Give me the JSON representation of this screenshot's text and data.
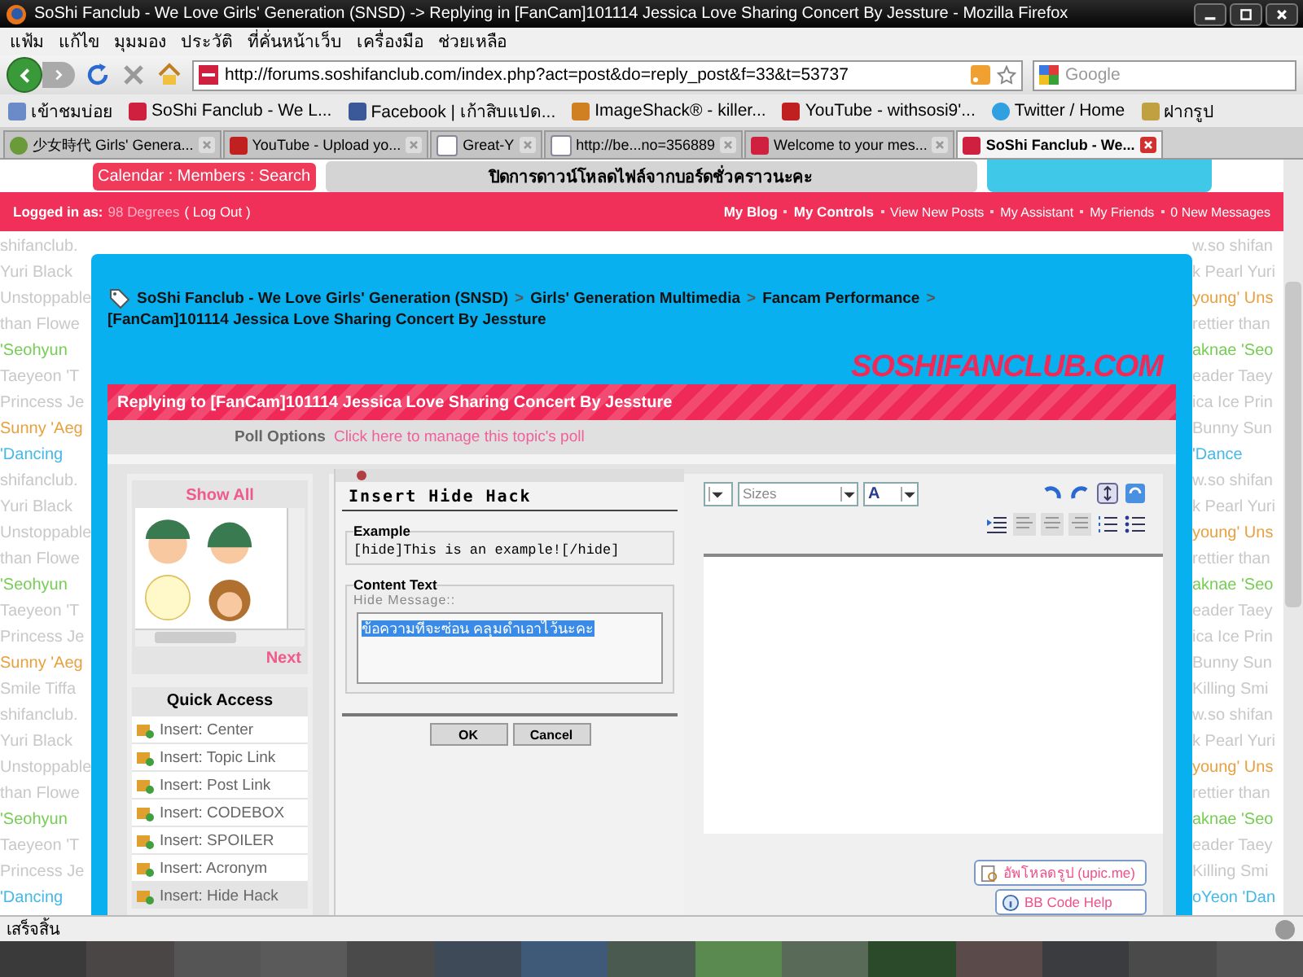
{
  "window": {
    "title": "SoShi Fanclub - We Love Girls' Generation (SNSD) -> Replying in [FanCam]101114 Jessica Love Sharing Concert By Jessture - Mozilla Firefox"
  },
  "menu": [
    "แฟ้ม",
    "แก้ไข",
    "มุมมอง",
    "ประวัติ",
    "ที่คั่นหน้าเว็บ",
    "เครื่องมือ",
    "ช่วยเหลือ"
  ],
  "nav": {
    "url": "http://forums.soshifanclub.com/index.php?act=post&do=reply_post&f=33&t=53737",
    "search_placeholder": "Google"
  },
  "bookmarks": [
    {
      "label": "เข้าชมบ่อย",
      "kind": "folder"
    },
    {
      "label": "SoShi Fanclub - We L...",
      "kind": "site"
    },
    {
      "label": "Facebook | เก้าสิบแปด...",
      "kind": "facebook"
    },
    {
      "label": "ImageShack® - killer...",
      "kind": "frog"
    },
    {
      "label": "YouTube - withsosi9'...",
      "kind": "youtube"
    },
    {
      "label": "Twitter / Home",
      "kind": "bird"
    },
    {
      "label": "ฝากรูป",
      "kind": "picture"
    }
  ],
  "tabs": [
    {
      "label": "少女時代 Girls' Genera...",
      "kind": "face",
      "selected": false
    },
    {
      "label": "YouTube - Upload yo...",
      "kind": "youtube",
      "selected": false
    },
    {
      "label": "Great-Y",
      "kind": "page",
      "selected": false
    },
    {
      "label": "http://be...no=356889",
      "kind": "page",
      "selected": false
    },
    {
      "label": "Welcome to your mes...",
      "kind": "site",
      "selected": false
    },
    {
      "label": "SoShi Fanclub - We...",
      "kind": "site",
      "selected": true
    }
  ],
  "page": {
    "top_links": "Calendar : Members : Search",
    "notice": "ปิดการดาวน์โหลดไฟล์จากบอร์ดชั่วคราวนะคะ",
    "user_bar": {
      "prefix": "Logged in as:",
      "user": "98 Degrees",
      "logout": "( Log Out )",
      "links": [
        {
          "label": "My Blog",
          "bold": true
        },
        {
          "label": "My Controls",
          "bold": true
        },
        {
          "label": "View New Posts",
          "bold": false
        },
        {
          "label": "My Assistant",
          "bold": false
        },
        {
          "label": "My Friends",
          "bold": false
        },
        {
          "label": "0 New Messages",
          "bold": false
        }
      ]
    }
  },
  "background_words": {
    "left": [
      {
        "text": "shifanclub.",
        "color": "#c8c8c8"
      },
      {
        "text": "Yuri Black",
        "color": "#c8c8c8"
      },
      {
        "text": "Unstoppable",
        "color": "#c8c8c8"
      },
      {
        "text": "than Flowe",
        "color": "#c8c8c8"
      },
      {
        "text": "'Seohyun",
        "color": "#77cc55"
      },
      {
        "text": "Taeyeon 'T",
        "color": "#c8c8c8"
      },
      {
        "text": "Princess Je",
        "color": "#c8c8c8"
      },
      {
        "text": "Sunny 'Aeg",
        "color": "#e8a040"
      },
      {
        "text": "'Dancing",
        "color": "#44b8e8"
      },
      {
        "text": "shifanclub.",
        "color": "#c8c8c8"
      },
      {
        "text": "Yuri Black",
        "color": "#c8c8c8"
      },
      {
        "text": "Unstoppable",
        "color": "#c8c8c8"
      },
      {
        "text": "than Flowe",
        "color": "#c8c8c8"
      },
      {
        "text": "'Seohyun",
        "color": "#77cc55"
      },
      {
        "text": "Taeyeon 'T",
        "color": "#c8c8c8"
      },
      {
        "text": "Princess Je",
        "color": "#c8c8c8"
      },
      {
        "text": "Sunny 'Aeg",
        "color": "#e8a040"
      },
      {
        "text": "Smile Tiffa",
        "color": "#c8c8c8"
      },
      {
        "text": "shifanclub.",
        "color": "#c8c8c8"
      },
      {
        "text": "Yuri Black",
        "color": "#c8c8c8"
      },
      {
        "text": "Unstoppable",
        "color": "#c8c8c8"
      },
      {
        "text": "than Flowe",
        "color": "#c8c8c8"
      },
      {
        "text": "'Seohyun",
        "color": "#77cc55"
      },
      {
        "text": "Taeyeon 'T",
        "color": "#c8c8c8"
      },
      {
        "text": "Princess Je",
        "color": "#c8c8c8"
      },
      {
        "text": "'Dancing",
        "color": "#44b8e8"
      }
    ],
    "right": [
      {
        "text": "w.so shifan",
        "color": "#c8c8c8"
      },
      {
        "text": "k Pearl Yuri",
        "color": "#c8c8c8"
      },
      {
        "text": "young' Uns",
        "color": "#e8a040"
      },
      {
        "text": "rettier than",
        "color": "#c8c8c8"
      },
      {
        "text": "aknae 'Seo",
        "color": "#77cc55"
      },
      {
        "text": "eader Taey",
        "color": "#c8c8c8"
      },
      {
        "text": "ica Ice Prin",
        "color": "#c8c8c8"
      },
      {
        "text": "Bunny Sun",
        "color": "#c8c8c8"
      },
      {
        "text": "'Dance",
        "color": "#44b8e8"
      },
      {
        "text": "w.so shifan",
        "color": "#c8c8c8"
      },
      {
        "text": "k Pearl Yuri",
        "color": "#c8c8c8"
      },
      {
        "text": "young' Uns",
        "color": "#e8a040"
      },
      {
        "text": "rettier than",
        "color": "#c8c8c8"
      },
      {
        "text": "aknae 'Seo",
        "color": "#77cc55"
      },
      {
        "text": "eader Taey",
        "color": "#c8c8c8"
      },
      {
        "text": "ica Ice Prin",
        "color": "#c8c8c8"
      },
      {
        "text": "Bunny Sun",
        "color": "#c8c8c8"
      },
      {
        "text": "Killing Smi",
        "color": "#c8c8c8"
      },
      {
        "text": "w.so shifan",
        "color": "#c8c8c8"
      },
      {
        "text": "k Pearl Yuri",
        "color": "#c8c8c8"
      },
      {
        "text": "young' Uns",
        "color": "#e8a040"
      },
      {
        "text": "rettier than",
        "color": "#c8c8c8"
      },
      {
        "text": "aknae 'Seo",
        "color": "#77cc55"
      },
      {
        "text": "eader Taey",
        "color": "#c8c8c8"
      },
      {
        "text": "Killing Smi",
        "color": "#c8c8c8"
      },
      {
        "text": "oYeon 'Dan",
        "color": "#44b8e8"
      }
    ]
  },
  "breadcrumb": [
    {
      "label": "SoShi Fanclub - We Love Girls' Generation (SNSD)",
      "separator": ">"
    },
    {
      "label": "Girls' Generation Multimedia",
      "separator": ">"
    },
    {
      "label": "Fancam Performance",
      "separator": ">"
    },
    {
      "label": "[FanCam]101114 Jessica Love Sharing Concert By Jessture"
    }
  ],
  "reply_header": "Replying to [FanCam]101114 Jessica Love Sharing Concert By Jessture",
  "logo_text": "SOSHIFANCLUB.COM",
  "poll": {
    "label": "Poll Options",
    "link": "Click here to manage this topic's poll"
  },
  "emoticons": {
    "show_all": "Show All",
    "next": "Next"
  },
  "quick_access": {
    "title": "Quick Access",
    "items": [
      {
        "label": "Insert: Center",
        "selected": false
      },
      {
        "label": "Insert: Topic Link",
        "selected": false
      },
      {
        "label": "Insert: Post Link",
        "selected": false
      },
      {
        "label": "Insert: CODEBOX",
        "selected": false
      },
      {
        "label": "Insert: SPOILER",
        "selected": false
      },
      {
        "label": "Insert: Acronym",
        "selected": false
      },
      {
        "label": "Insert: Hide Hack",
        "selected": true
      }
    ]
  },
  "editor": {
    "size_select": "Sizes",
    "font_color": "A"
  },
  "side_buttons": [
    {
      "label": "อัพโหลดรูป (upic.me)",
      "kind": "upload"
    },
    {
      "label": "BB Code Help",
      "kind": "help"
    }
  ],
  "dialog": {
    "title": "Insert Hide Hack",
    "example_legend": "Example",
    "example": "[hide]This is an example![/hide]",
    "content_legend": "Content Text",
    "field_label": "Hide Message::",
    "value": "ข้อความที่จะซ่อน  คลุมดำเอาไว้นะคะ",
    "buttons": [
      "OK",
      "Cancel"
    ]
  },
  "status_bar": "เสร็จสิ้น"
}
